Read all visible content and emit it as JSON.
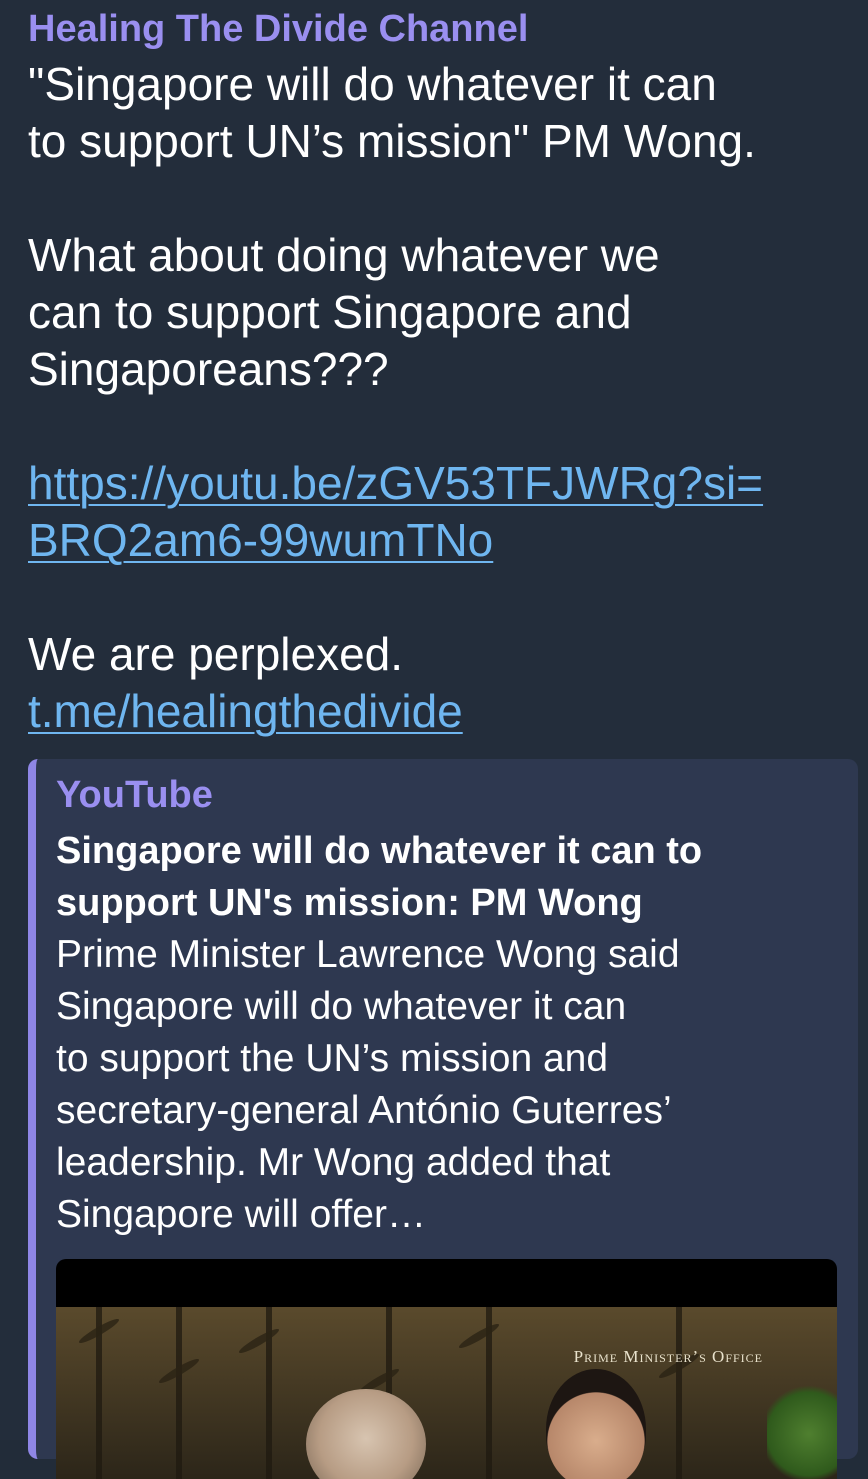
{
  "post": {
    "channel_name": "Healing The Divide Channel",
    "lines": {
      "l1": "\"Singapore will do whatever it can",
      "l2": "to support UN’s mission\" PM Wong.",
      "l3": "What about doing whatever we",
      "l4": "can to support Singapore and",
      "l5": "Singaporeans???",
      "link_line1": "https://youtu.be/zGV53TFJWRg?si=",
      "link_line2": "BRQ2am6-99wumTNo",
      "l6": "We are perplexed.",
      "channel_link": "t.me/healingthedivide"
    }
  },
  "preview": {
    "site": "YouTube",
    "title_lines": [
      "Singapore will do whatever it can to",
      "support UN's mission: PM Wong"
    ],
    "desc_lines": [
      "Prime Minister Lawrence Wong said",
      "Singapore will do whatever it can",
      "to support the UN’s mission and",
      "secretary-general António Guterres’",
      "leadership. Mr Wong added that",
      "Singapore will offer…"
    ],
    "thumbnail_caption": "Prime Minister’s Office"
  },
  "colors": {
    "background": "#232d3b",
    "accent": "#9a8ff0",
    "link": "#6fb6f0",
    "preview_background": "#2e3850"
  }
}
